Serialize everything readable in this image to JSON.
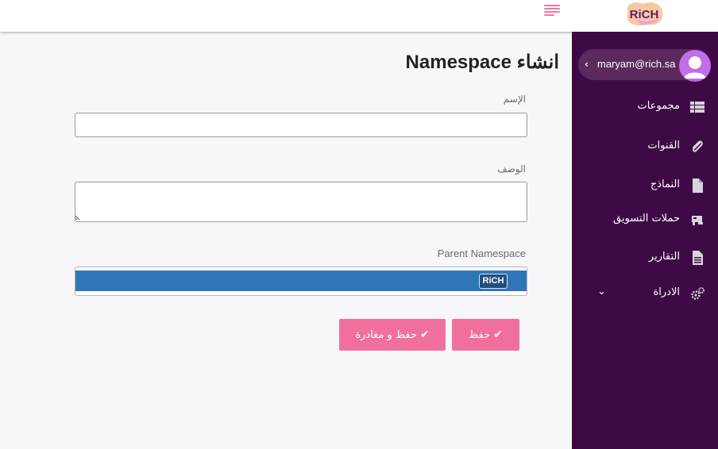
{
  "header": {
    "logo_text": "RiCH",
    "menu_icon": "hamburger-icon"
  },
  "sidebar": {
    "user_email": "maryam@rich.sa",
    "items": [
      {
        "label": "مجموعات",
        "icon": "table-icon"
      },
      {
        "label": "القنوات",
        "icon": "paperclip-icon"
      },
      {
        "label": "النماذج",
        "icon": "file-icon"
      },
      {
        "label": "حملات التسويق",
        "icon": "megaphone-icon"
      },
      {
        "label": "التقارير",
        "icon": "file-text-icon"
      },
      {
        "label": "الادراة",
        "icon": "gears-icon"
      }
    ]
  },
  "form": {
    "title": "انشاء Namespace",
    "name_label": "الإسم",
    "name_value": "",
    "description_label": "الوصف",
    "description_value": "",
    "parent_label": "Parent Namespace",
    "parent_selected": "RiCH",
    "save_label": "حفظ",
    "save_exit_label": "حفظ و مغادرة"
  },
  "colors": {
    "sidebar_bg": "#3e0a46",
    "accent_pink": "#f06f9e",
    "select_blue": "#2f76b8"
  }
}
